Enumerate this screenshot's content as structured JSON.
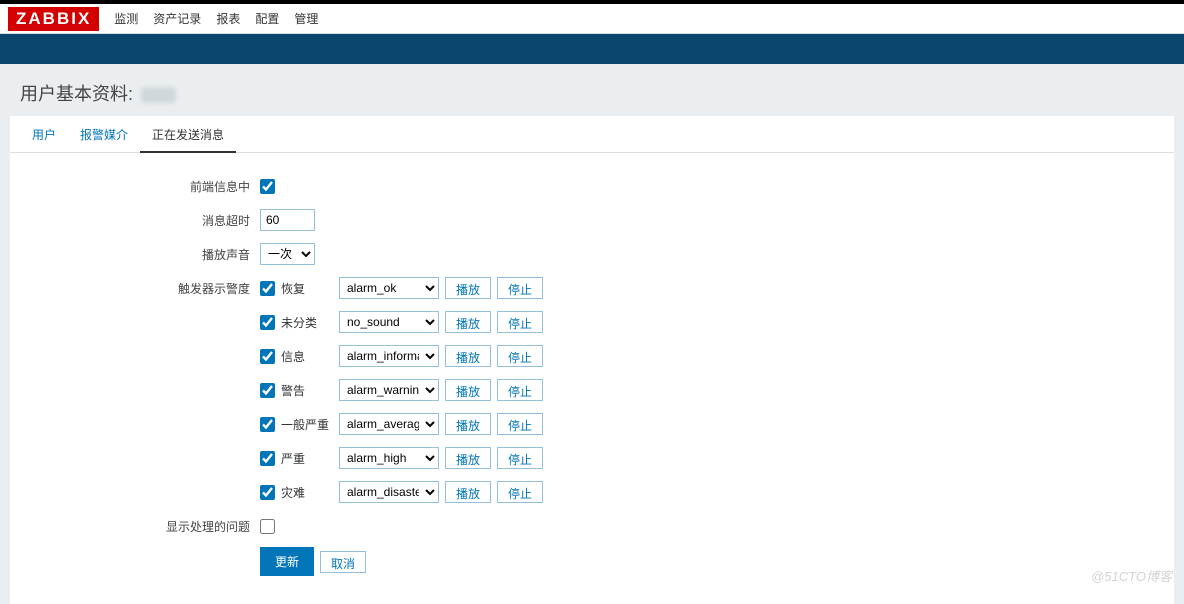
{
  "logo": "ZABBIX",
  "nav": [
    "监测",
    "资产记录",
    "报表",
    "配置",
    "管理"
  ],
  "page_title": "用户基本资料:",
  "tabs": {
    "user": "用户",
    "media": "报警媒介",
    "messaging": "正在发送消息"
  },
  "labels": {
    "frontend": "前端信息中",
    "timeout": "消息超时",
    "playsound": "播放声音",
    "severity": "触发器示警度",
    "suppressed": "显示处理的问题"
  },
  "timeout_value": "60",
  "play_sound_options": [
    "一次"
  ],
  "play_sound_selected": "一次",
  "severities": [
    {
      "label": "恢复",
      "sound": "alarm_ok"
    },
    {
      "label": "未分类",
      "sound": "no_sound"
    },
    {
      "label": "信息",
      "sound": "alarm_information"
    },
    {
      "label": "警告",
      "sound": "alarm_warning"
    },
    {
      "label": "一般严重",
      "sound": "alarm_average"
    },
    {
      "label": "严重",
      "sound": "alarm_high"
    },
    {
      "label": "灾难",
      "sound": "alarm_disaster"
    }
  ],
  "buttons": {
    "play": "播放",
    "stop": "停止",
    "update": "更新",
    "cancel": "取消"
  },
  "watermark": "@51CTO博客"
}
